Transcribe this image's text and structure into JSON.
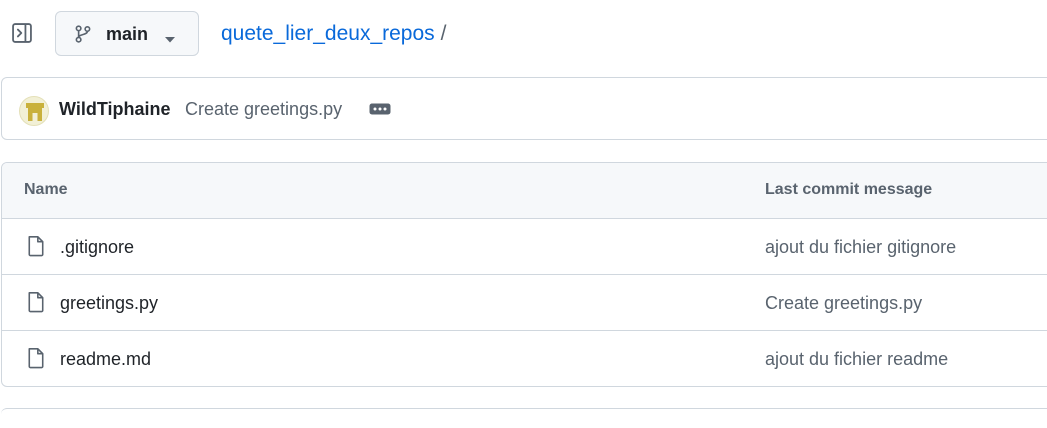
{
  "toolbar": {
    "sidebar_toggle_icon": "sidebar-expand-icon",
    "branch": {
      "icon": "git-branch-icon",
      "label": "main",
      "caret_icon": "triangle-down-icon"
    }
  },
  "breadcrumb": {
    "repo": "quete_lier_deux_repos",
    "separator": "/"
  },
  "latest_commit": {
    "avatar_icon": "user-avatar",
    "author": "WildTiphaine",
    "message": "Create greetings.py",
    "more_icon": "kebab-horizontal-icon"
  },
  "file_table": {
    "headers": {
      "name": "Name",
      "last_commit": "Last commit message"
    },
    "rows": [
      {
        "icon": "file-icon",
        "name": ".gitignore",
        "message": "ajout du fichier gitignore"
      },
      {
        "icon": "file-icon",
        "name": "greetings.py",
        "message": "Create greetings.py"
      },
      {
        "icon": "file-icon",
        "name": "readme.md",
        "message": "ajout du fichier readme"
      }
    ]
  },
  "colors": {
    "link": "#0969da",
    "text": "#1f2328",
    "muted": "#59636e",
    "border": "#d0d7de",
    "header_bg": "#f6f8fa"
  }
}
